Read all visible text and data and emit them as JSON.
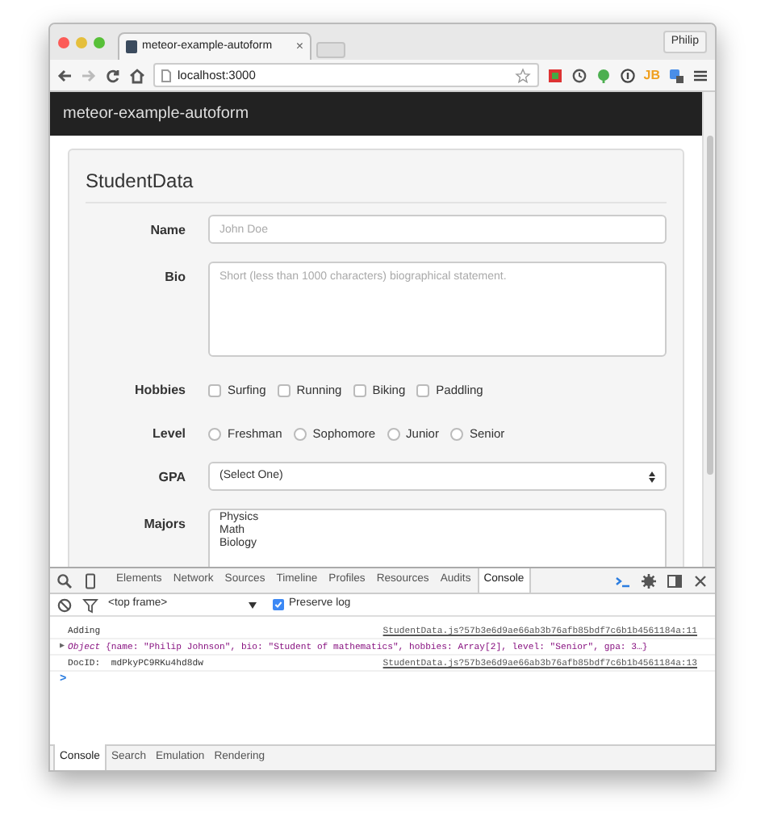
{
  "browser": {
    "tab_title": "meteor-example-autoform",
    "tab_close": "×",
    "profile": "Philip",
    "url": "localhost:3000",
    "extension_label": "JB"
  },
  "navbar": {
    "brand": "meteor-example-autoform"
  },
  "form": {
    "title": "StudentData",
    "fields": [
      {
        "kind": "text",
        "label": "Name",
        "placeholder": "John Doe"
      },
      {
        "kind": "textarea",
        "label": "Bio",
        "placeholder": "Short (less than 1000 characters) biographical statement."
      },
      {
        "kind": "checkboxes",
        "label": "Hobbies",
        "options": [
          {
            "label": "Surfing",
            "checked": false
          },
          {
            "label": "Running",
            "checked": false
          },
          {
            "label": "Biking",
            "checked": false
          },
          {
            "label": "Paddling",
            "checked": false
          }
        ]
      },
      {
        "kind": "radios",
        "label": "Level",
        "options": [
          {
            "label": "Freshman",
            "selected": false
          },
          {
            "label": "Sophomore",
            "selected": false
          },
          {
            "label": "Junior",
            "selected": false
          },
          {
            "label": "Senior",
            "selected": false
          }
        ]
      },
      {
        "kind": "select",
        "label": "GPA",
        "value": "(Select One)"
      },
      {
        "kind": "listbox",
        "label": "Majors",
        "options": [
          "Physics",
          "Math",
          "Biology"
        ]
      }
    ]
  },
  "devtools": {
    "tabs": [
      {
        "label": "Elements",
        "selected": false
      },
      {
        "label": "Network",
        "selected": false
      },
      {
        "label": "Sources",
        "selected": false
      },
      {
        "label": "Timeline",
        "selected": false
      },
      {
        "label": "Profiles",
        "selected": false
      },
      {
        "label": "Resources",
        "selected": false
      },
      {
        "label": "Audits",
        "selected": false
      },
      {
        "label": "Console",
        "selected": true
      }
    ],
    "context": "<top frame>",
    "preserve_log": {
      "label": "Preserve log",
      "checked": true
    },
    "console": [
      {
        "kind": "log",
        "text": "Adding",
        "source": "StudentData.js?57b3e6d9ae66ab3b76afb85bdf7c6b1b4561184a:11"
      },
      {
        "kind": "object",
        "expander": "▶",
        "text": "*Object* {name: \"Philip Johnson\", bio: \"Student of mathematics\", hobbies: Array[2], level: \"Senior\", gpa: 3…}"
      },
      {
        "kind": "log",
        "text": "DocID:  mdPkyPC9RKu4hd8dw",
        "source": "StudentData.js?57b3e6d9ae66ab3b76afb85bdf7c6b1b4561184a:13"
      }
    ],
    "prompt": ">",
    "drawer_tabs": [
      {
        "label": "Console",
        "selected": true
      },
      {
        "label": "Search",
        "selected": false
      },
      {
        "label": "Emulation",
        "selected": false
      },
      {
        "label": "Rendering",
        "selected": false
      }
    ]
  }
}
